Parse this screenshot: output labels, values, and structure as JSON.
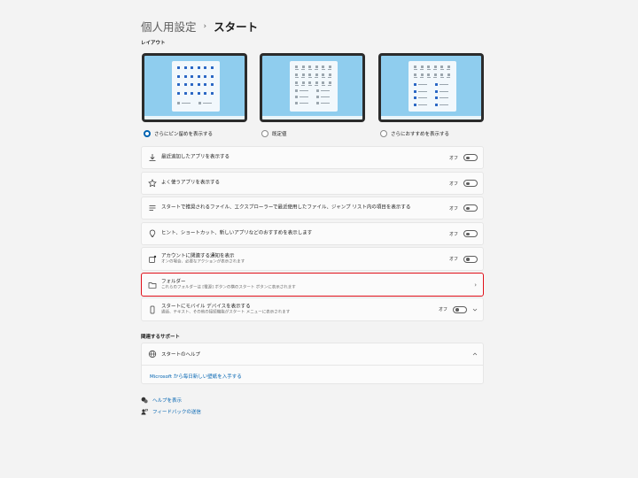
{
  "breadcrumb": {
    "parent": "個人用設定",
    "separator": "›",
    "current": "スタート"
  },
  "layout_section": {
    "label": "レイアウト"
  },
  "layouts": [
    {
      "label": "さらにピン留めを表示する",
      "selected": true
    },
    {
      "label": "既定値",
      "selected": false
    },
    {
      "label": "さらにおすすめを表示する",
      "selected": false
    }
  ],
  "settings": [
    {
      "title": "最近追加したアプリを表示する",
      "state": "オフ",
      "icon": "download-icon"
    },
    {
      "title": "よく使うアプリを表示する",
      "state": "オフ",
      "icon": "star-icon"
    },
    {
      "title": "スタートで推奨されるファイル、エクスプローラーで最近使用したファイル、ジャンプ リスト内の項目を表示する",
      "state": "オフ",
      "icon": "list-icon"
    },
    {
      "title": "ヒント、ショートカット、新しいアプリなどのおすすめを表示します",
      "state": "オフ",
      "icon": "lightbulb-icon"
    },
    {
      "title": "アカウントに関連する通知を表示",
      "subtitle": "オンの場合、必要なアクションが表示されます",
      "state": "オフ",
      "icon": "account-notification-icon"
    },
    {
      "title": "フォルダー",
      "subtitle": "これらのフォルダーは [電源] ボタンの横のスタート ボタンに表示されます",
      "icon": "folder-icon"
    },
    {
      "title": "スタートにモバイル デバイスを表示する",
      "subtitle": "通話、テキスト、その他の接続機能がスタート メニューに表示されます",
      "state": "オフ",
      "icon": "phone-icon"
    }
  ],
  "support_section": {
    "label": "関連するサポート",
    "help_title": "スタートのヘルプ",
    "help_link": "Microsoft から毎日新しい壁紙を入手する"
  },
  "footer": {
    "get_help": "ヘルプを表示",
    "feedback": "フィードバックの送信"
  },
  "colors": {
    "accent": "#0063b1",
    "highlight": "#e0101a",
    "background": "#f3f3f3"
  }
}
